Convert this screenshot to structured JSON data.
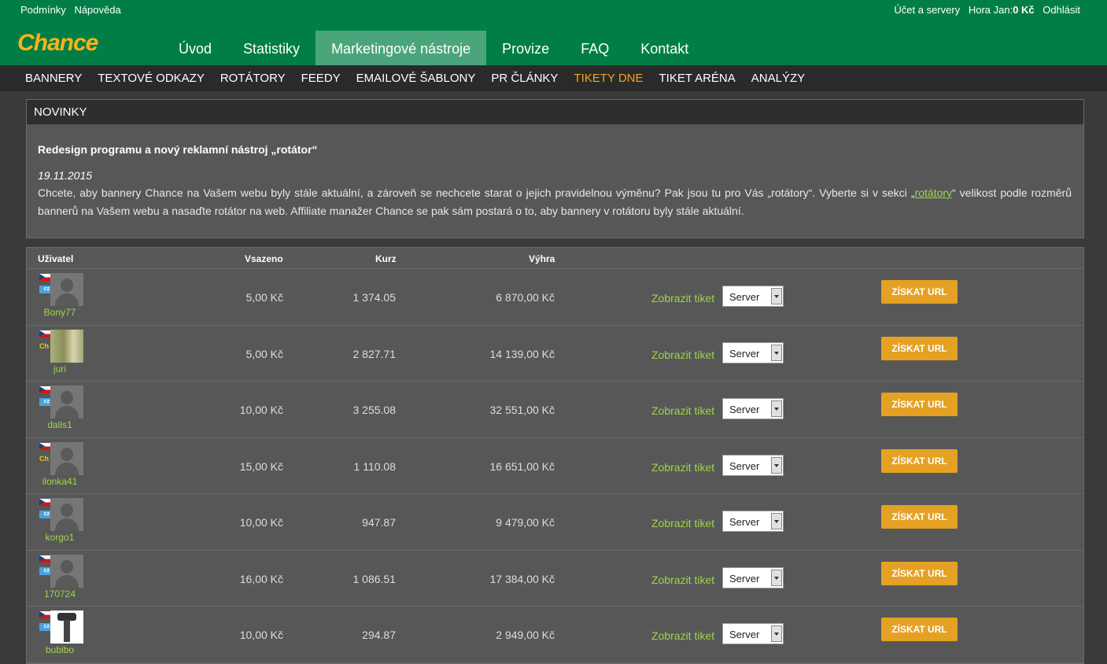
{
  "topbar": {
    "left_links": [
      "Podmínky",
      "Nápověda"
    ],
    "account_link": "Účet a servery",
    "user_label": "Hora Jan:",
    "balance": "0 Kč",
    "logout": "Odhlásit"
  },
  "brand": {
    "logo_text": "Chance",
    "logo_color": "#f7b21b",
    "header_color": "#007e46"
  },
  "mainnav": {
    "items": [
      "Úvod",
      "Statistiky",
      "Marketingové nástroje",
      "Provize",
      "FAQ",
      "Kontakt"
    ],
    "active": "Marketingové nástroje"
  },
  "subnav": {
    "items": [
      "BANNERY",
      "TEXTOVÉ ODKAZY",
      "ROTÁTORY",
      "FEEDY",
      "EMAILOVÉ ŠABLONY",
      "PR ČLÁNKY",
      "TIKETY DNE",
      "TIKET ARÉNA",
      "ANALÝZY"
    ],
    "active": "TIKETY DNE",
    "active_color": "#f2a31c"
  },
  "news": {
    "heading": "NOVINKY",
    "title": "Redesign programu a nový reklamní nástroj „rotátor“",
    "date": "19.11.2015",
    "body_part1": "Chcete, aby bannery Chance na Vašem webu byly stále aktuální, a zároveň se nechcete starat o jejich pravidelnou výměnu? Pak jsou tu pro Vás „rotátory“. Vyberte si v sekci „",
    "body_link": "rotátory",
    "body_part2": "“ velikost podle rozměrů bannerů na Vašem webu a nasaďte rotátor na web. Affiliate manažer Chance se pak sám postará o to, aby bannery v rotátoru byly stále aktuální."
  },
  "table": {
    "headers": {
      "user": "Uživatel",
      "stake": "Vsazeno",
      "odds": "Kurz",
      "win": "Výhra"
    },
    "show_ticket_label": "Zobrazit tiket",
    "server_default": "Server",
    "get_url_label": "ZÍSKAT URL",
    "rows": [
      {
        "user": "Bony77",
        "lang": "cz",
        "avatar": "default-avatar-icon",
        "stake": "5,00 Kč",
        "odds": "1 374.05",
        "win": "6 870,00 Kč"
      },
      {
        "user": "juri",
        "lang": "ch",
        "avatar": "photo-avatar",
        "stake": "5,00 Kč",
        "odds": "2 827.71",
        "win": "14 139,00 Kč"
      },
      {
        "user": "dalis1",
        "lang": "cz",
        "avatar": "default-avatar-icon",
        "stake": "10,00 Kč",
        "odds": "3 255.08",
        "win": "32 551,00 Kč"
      },
      {
        "user": "ilonka41",
        "lang": "ch",
        "avatar": "default-avatar-icon",
        "stake": "15,00 Kč",
        "odds": "1 110.08",
        "win": "16 651,00 Kč"
      },
      {
        "user": "korgo1",
        "lang": "cz",
        "avatar": "default-avatar-icon",
        "stake": "10,00 Kč",
        "odds": "947.87",
        "win": "9 479,00 Kč"
      },
      {
        "user": "170724",
        "lang": "cz",
        "avatar": "default-avatar-icon",
        "stake": "16,00 Kč",
        "odds": "1 086.51",
        "win": "17 384,00 Kč"
      },
      {
        "user": "bubibo",
        "lang": "cz",
        "avatar": "image-avatar",
        "stake": "10,00 Kč",
        "odds": "294.87",
        "win": "2 949,00 Kč"
      }
    ]
  }
}
